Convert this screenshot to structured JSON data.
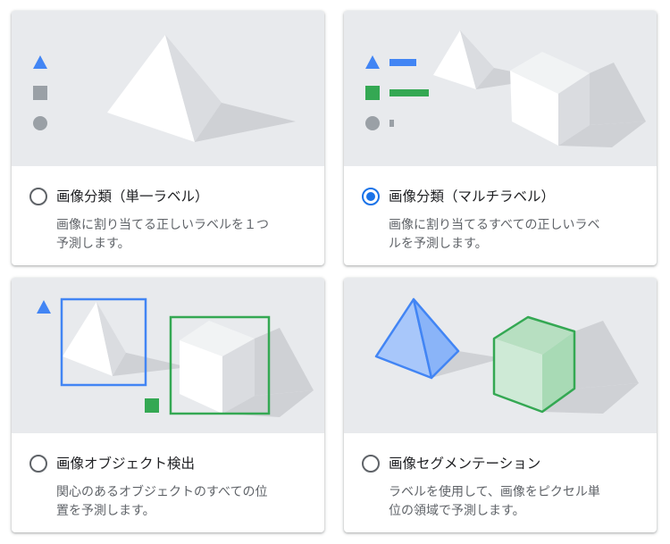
{
  "options": [
    {
      "title": "画像分類（単一ラベル）",
      "desc_lines": [
        "画像に割り当てる正しいラベルを１つ",
        "予測します。"
      ],
      "selected": false,
      "icons": [
        "triangle-icon",
        "square-icon",
        "circle-icon"
      ]
    },
    {
      "title": "画像分類（マルチラベル）",
      "desc_lines": [
        "画像に割り当てるすべての正しいラベ",
        "ルを予測します。"
      ],
      "selected": true,
      "icons": [
        "triangle-icon",
        "square-icon",
        "circle-icon"
      ]
    },
    {
      "title": "画像オブジェクト検出",
      "desc_lines": [
        "関心のあるオブジェクトのすべての位",
        "置を予測します。"
      ],
      "selected": false,
      "icons": [
        "triangle-icon",
        "square-icon"
      ]
    },
    {
      "title": "画像セグメンテーション",
      "desc_lines": [
        "ラベルを使用して、画像をピクセル単",
        "位の領域で予測します。"
      ],
      "selected": false,
      "icons": []
    }
  ],
  "colors": {
    "blue": "#4285f4",
    "green": "#34a853",
    "gray": "#9aa0a6",
    "radio_selected": "#1a73e8",
    "illustration_bg": "#e8eaed"
  }
}
